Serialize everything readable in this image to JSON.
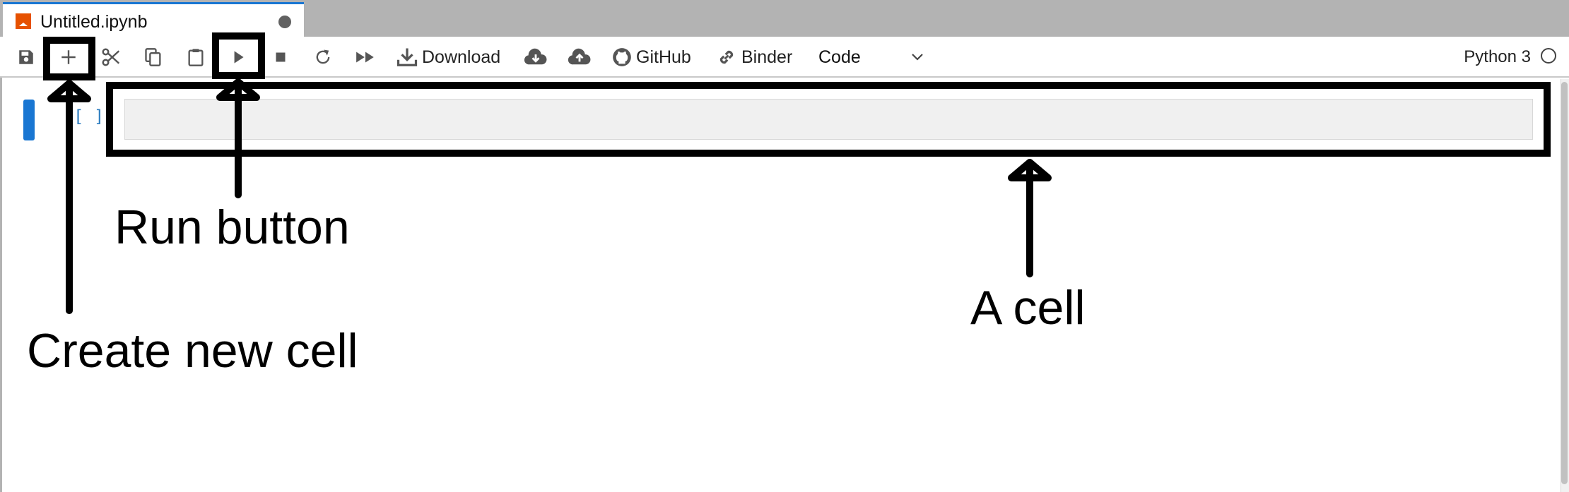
{
  "tab": {
    "title": "Untitled.ipynb",
    "icon": "notebook-icon",
    "unsaved_indicator": "dot"
  },
  "toolbar": {
    "buttons": [
      {
        "name": "save",
        "icon": "save-icon"
      },
      {
        "name": "insert-cell",
        "icon": "plus-icon"
      },
      {
        "name": "cut",
        "icon": "scissors-icon"
      },
      {
        "name": "copy",
        "icon": "copy-icon"
      },
      {
        "name": "paste",
        "icon": "clipboard-icon"
      },
      {
        "name": "run",
        "icon": "play-icon"
      },
      {
        "name": "interrupt",
        "icon": "stop-icon"
      },
      {
        "name": "restart",
        "icon": "refresh-icon"
      },
      {
        "name": "restart-run-all",
        "icon": "fast-forward-icon"
      }
    ],
    "download_label": "Download",
    "github_label": "GitHub",
    "binder_label": "Binder",
    "cell_type": "Code",
    "kernel_name": "Python 3"
  },
  "cell": {
    "prompt": "[ ]",
    "content": ""
  },
  "annotations": {
    "create_cell": "Create new cell",
    "run_button": "Run button",
    "a_cell": "A cell"
  },
  "colors": {
    "accent": "#1976d2",
    "tab_icon": "#e65100",
    "prompt": "#307fc1",
    "tabbar": "#b3b3b3"
  }
}
